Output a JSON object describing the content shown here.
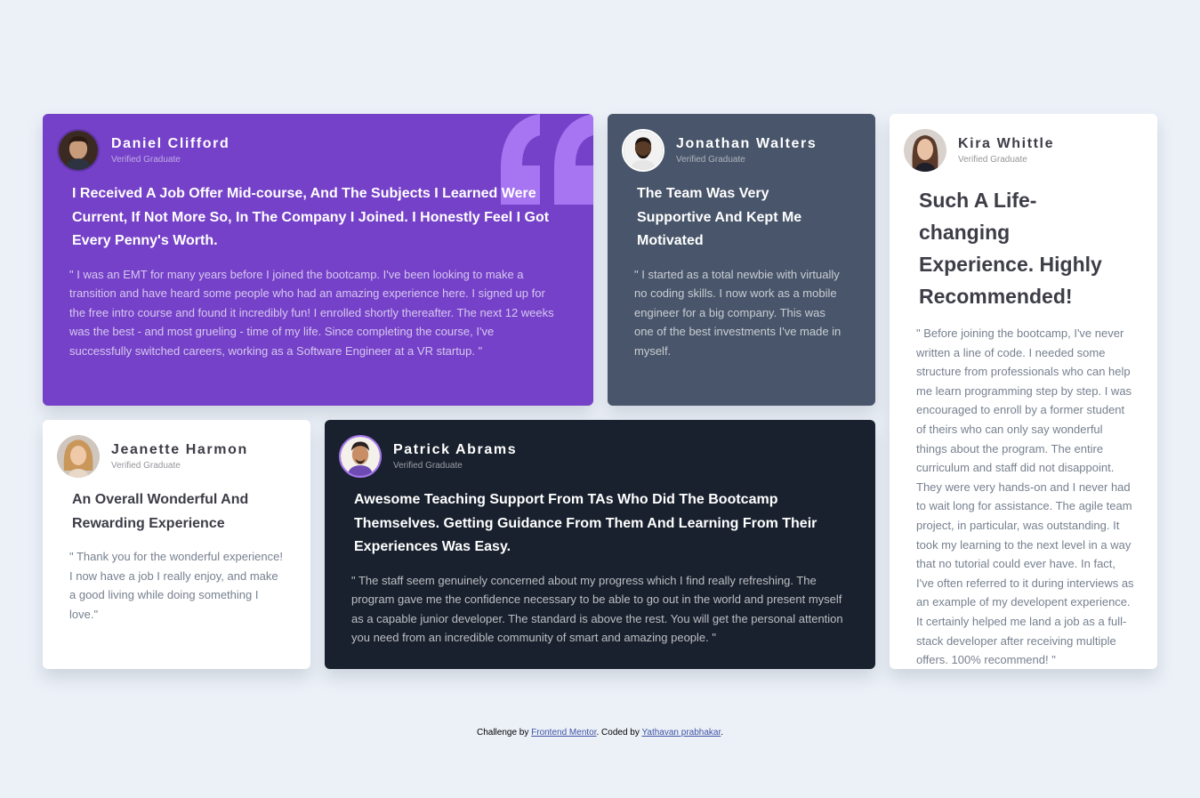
{
  "cards": [
    {
      "name": "Daniel Clifford",
      "role": "Verified Graduate",
      "headline": "I Received A Job Offer Mid-course, And The Subjects I Learned Were Current, If Not More So, In The Company I Joined. I Honestly Feel I Got Every Penny's Worth.",
      "body": "\" I was an EMT for many years before I joined the bootcamp. I've been looking to make a transition and have heard some people who had an amazing experience here. I signed up for the free intro course and found it incredibly fun! I enrolled shortly thereafter. The next 12 weeks was the best - and most grueling - time of my life. Since completing the course, I've successfully switched careers, working as a Software Engineer at a VR startup. \"",
      "background": "#7541c8"
    },
    {
      "name": "Jonathan Walters",
      "role": "Verified Graduate",
      "headline": "The Team Was Very Supportive And Kept Me Motivated",
      "body": "\" I started as a total newbie with virtually no coding skills. I now work as a mobile engineer for a big company. This was one of the best investments I've made in myself.",
      "background": "#48556a"
    },
    {
      "name": "Kira Whittle",
      "role": "Verified Graduate",
      "headline": "Such A Life-changing Experience. Highly Recommended!",
      "body": "\" Before joining the bootcamp, I've never written a line of code. I needed some structure from professionals who can help me learn programming step by step. I was encouraged to enroll by a former student of theirs who can only say wonderful things about the program. The entire curriculum and staff did not disappoint. They were very hands-on and I never had to wait long for assistance. The agile team project, in particular, was outstanding. It took my learning to the next level in a way that no tutorial could ever have. In fact, I've often referred to it during interviews as an example of my developent experience. It certainly helped me land a job as a full-stack developer after receiving multiple offers. 100% recommend! \"",
      "background": "#ffffff"
    },
    {
      "name": "Jeanette Harmon",
      "role": "Verified Graduate",
      "headline": "An Overall Wonderful And Rewarding Experience",
      "body": "\" Thank you for the wonderful experience! I now have a job I really enjoy, and make a good living while doing something I love.\"",
      "background": "#ffffff"
    },
    {
      "name": "Patrick Abrams",
      "role": "Verified Graduate",
      "headline": "Awesome Teaching Support From TAs Who Did The Bootcamp Themselves. Getting Guidance From Them And Learning From Their Experiences Was Easy.",
      "body": "\" The staff seem genuinely concerned about my progress which I find really refreshing. The program gave me the confidence necessary to be able to go out in the world and present myself as a capable junior developer. The standard is above the rest. You will get the personal attention you need from an incredible community of smart and amazing people. \"",
      "background": "#19212e"
    }
  ],
  "footer": {
    "prefix": "Challenge by ",
    "link1": "Frontend Mentor",
    "middle": ". Coded by ",
    "link2": "Yathavan prabhakar",
    "suffix": "."
  },
  "colors": {
    "page_bg": "#ecf1f8",
    "purple": "#7541c8",
    "quote_icon": "#a775f1",
    "link": "#3e52a3"
  },
  "icons": {
    "quote": "quote-icon"
  }
}
